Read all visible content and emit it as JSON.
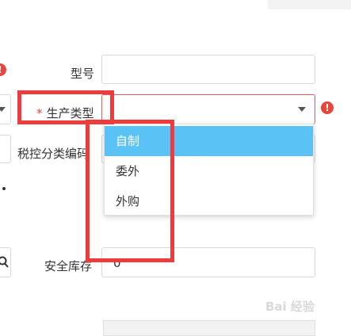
{
  "form": {
    "model_label": "型号",
    "production_type": {
      "required_mark": "*",
      "label": "生产类型",
      "value": ""
    },
    "tax_category_label": "税控分类编码",
    "safety_stock": {
      "label": "安全库存",
      "value": "0"
    }
  },
  "dropdown": {
    "options": [
      "自制",
      "委外",
      "外购"
    ],
    "selected": "自制"
  },
  "icons": {
    "error": "error-circle-icon",
    "search": "search-icon",
    "caret": "chevron-down-icon"
  },
  "colors": {
    "error": "#e8453c",
    "selected_option": "#5ac2f5",
    "annotation": "#ee3b3b"
  },
  "watermark": {
    "text": "Bai 经验"
  }
}
